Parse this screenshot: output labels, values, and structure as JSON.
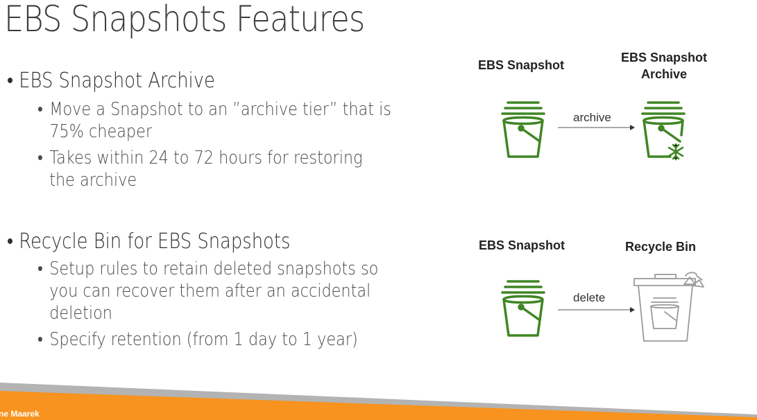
{
  "slide": {
    "title": "EBS Snapshots Features",
    "sections": [
      {
        "heading": "EBS Snapshot Archive",
        "points": [
          [
            "Move a Snapshot to an ”archive tier” that is",
            "75% cheaper"
          ],
          [
            "Takes within 24 to 72 hours for restoring",
            "the archive"
          ]
        ]
      },
      {
        "heading": "Recycle Bin for EBS Snapshots",
        "points": [
          [
            "Setup rules to retain deleted snapshots so",
            "you can recover them after an accidental",
            "deletion"
          ],
          [
            "Specify retention (from 1 day to 1 year)"
          ]
        ]
      }
    ],
    "footer_author": "ne Maarek"
  },
  "diagrams": {
    "archive": {
      "source_label": "EBS Snapshot",
      "target_label_line1": "EBS Snapshot",
      "target_label_line2": "Archive",
      "edge_label": "archive"
    },
    "recycle": {
      "source_label": "EBS Snapshot",
      "target_label": "Recycle Bin",
      "edge_label": "delete"
    }
  },
  "colors": {
    "icon_green": "#3f8624",
    "bin_gray": "#9a9a9a",
    "footer_orange": "#f7931e",
    "footer_gray": "#b3b3b3"
  },
  "icons": [
    "ebs-snapshot-icon",
    "ebs-snapshot-archive-icon",
    "recycle-bin-icon",
    "arrow-right-icon"
  ]
}
